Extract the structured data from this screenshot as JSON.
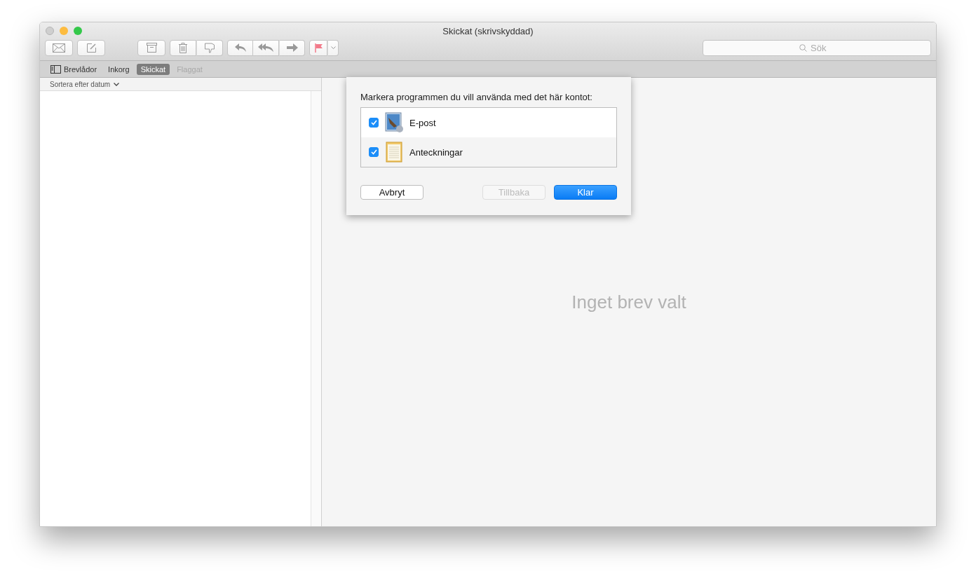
{
  "window": {
    "title": "Skickat (skrivskyddad)"
  },
  "search": {
    "placeholder": "Sök"
  },
  "tabs": [
    {
      "label": "Brevlådor",
      "kind": "sidebar",
      "selected": false,
      "disabled": false
    },
    {
      "label": "Inkorg",
      "kind": "plain",
      "selected": false,
      "disabled": false
    },
    {
      "label": "Skickat",
      "kind": "plain",
      "selected": true,
      "disabled": false
    },
    {
      "label": "Flaggat",
      "kind": "plain",
      "selected": false,
      "disabled": true
    }
  ],
  "sort": {
    "label": "Sortera efter datum"
  },
  "message_view": {
    "empty_text": "Inget brev valt"
  },
  "dialog": {
    "prompt": "Markera programmen du vill använda med det här kontot:",
    "apps": [
      {
        "label": "E-post",
        "kind": "mail",
        "checked": true
      },
      {
        "label": "Anteckningar",
        "kind": "notes",
        "checked": true
      }
    ],
    "buttons": [
      {
        "label": "Avbryt",
        "kind": "cancel",
        "disabled": false
      },
      {
        "label": "Tillbaka",
        "kind": "back",
        "disabled": true
      },
      {
        "label": "Klar",
        "kind": "default",
        "disabled": false
      }
    ]
  }
}
